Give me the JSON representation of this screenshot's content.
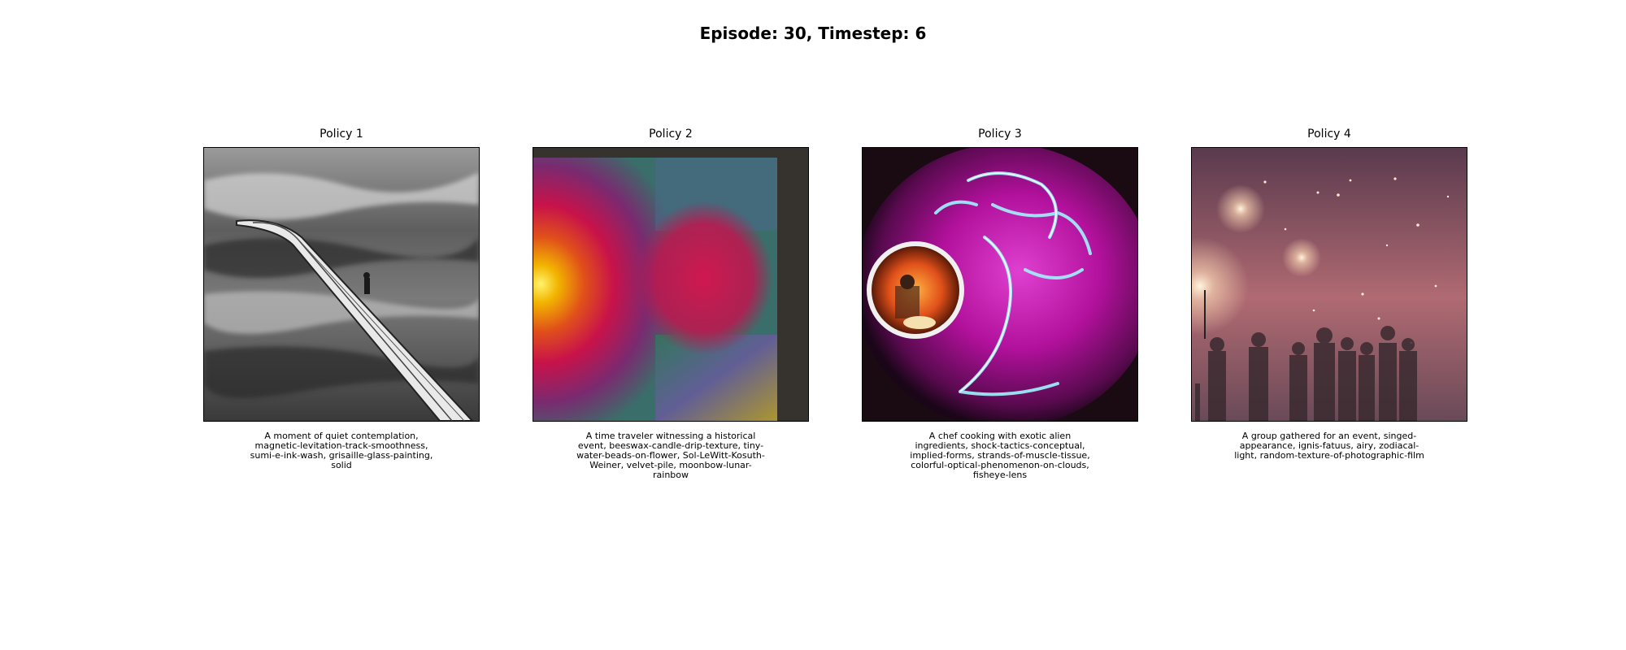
{
  "figure": {
    "title": "Episode: 30, Timestep: 6"
  },
  "panels": [
    {
      "title": "Policy 1",
      "caption": "A moment of quiet contemplation, magnetic-levitation-track-smoothness, sumi-e-ink-wash, grisaille-glass-painting, solid"
    },
    {
      "title": "Policy 2",
      "caption": "A time traveler witnessing a historical event, beeswax-candle-drip-texture, tiny-water-beads-on-flower, Sol-LeWitt-Kosuth-Weiner, velvet-pile, moonbow-lunar-rainbow"
    },
    {
      "title": "Policy 3",
      "caption": "A chef cooking with exotic alien ingredients, shock-tactics-conceptual, implied-forms, strands-of-muscle-tissue, colorful-optical-phenomenon-on-clouds, fisheye-lens"
    },
    {
      "title": "Policy 4",
      "caption": "A group gathered for an event, singed-appearance, ignis-fatuus, airy, zodiacal-light, random-texture-of-photographic-film"
    }
  ]
}
